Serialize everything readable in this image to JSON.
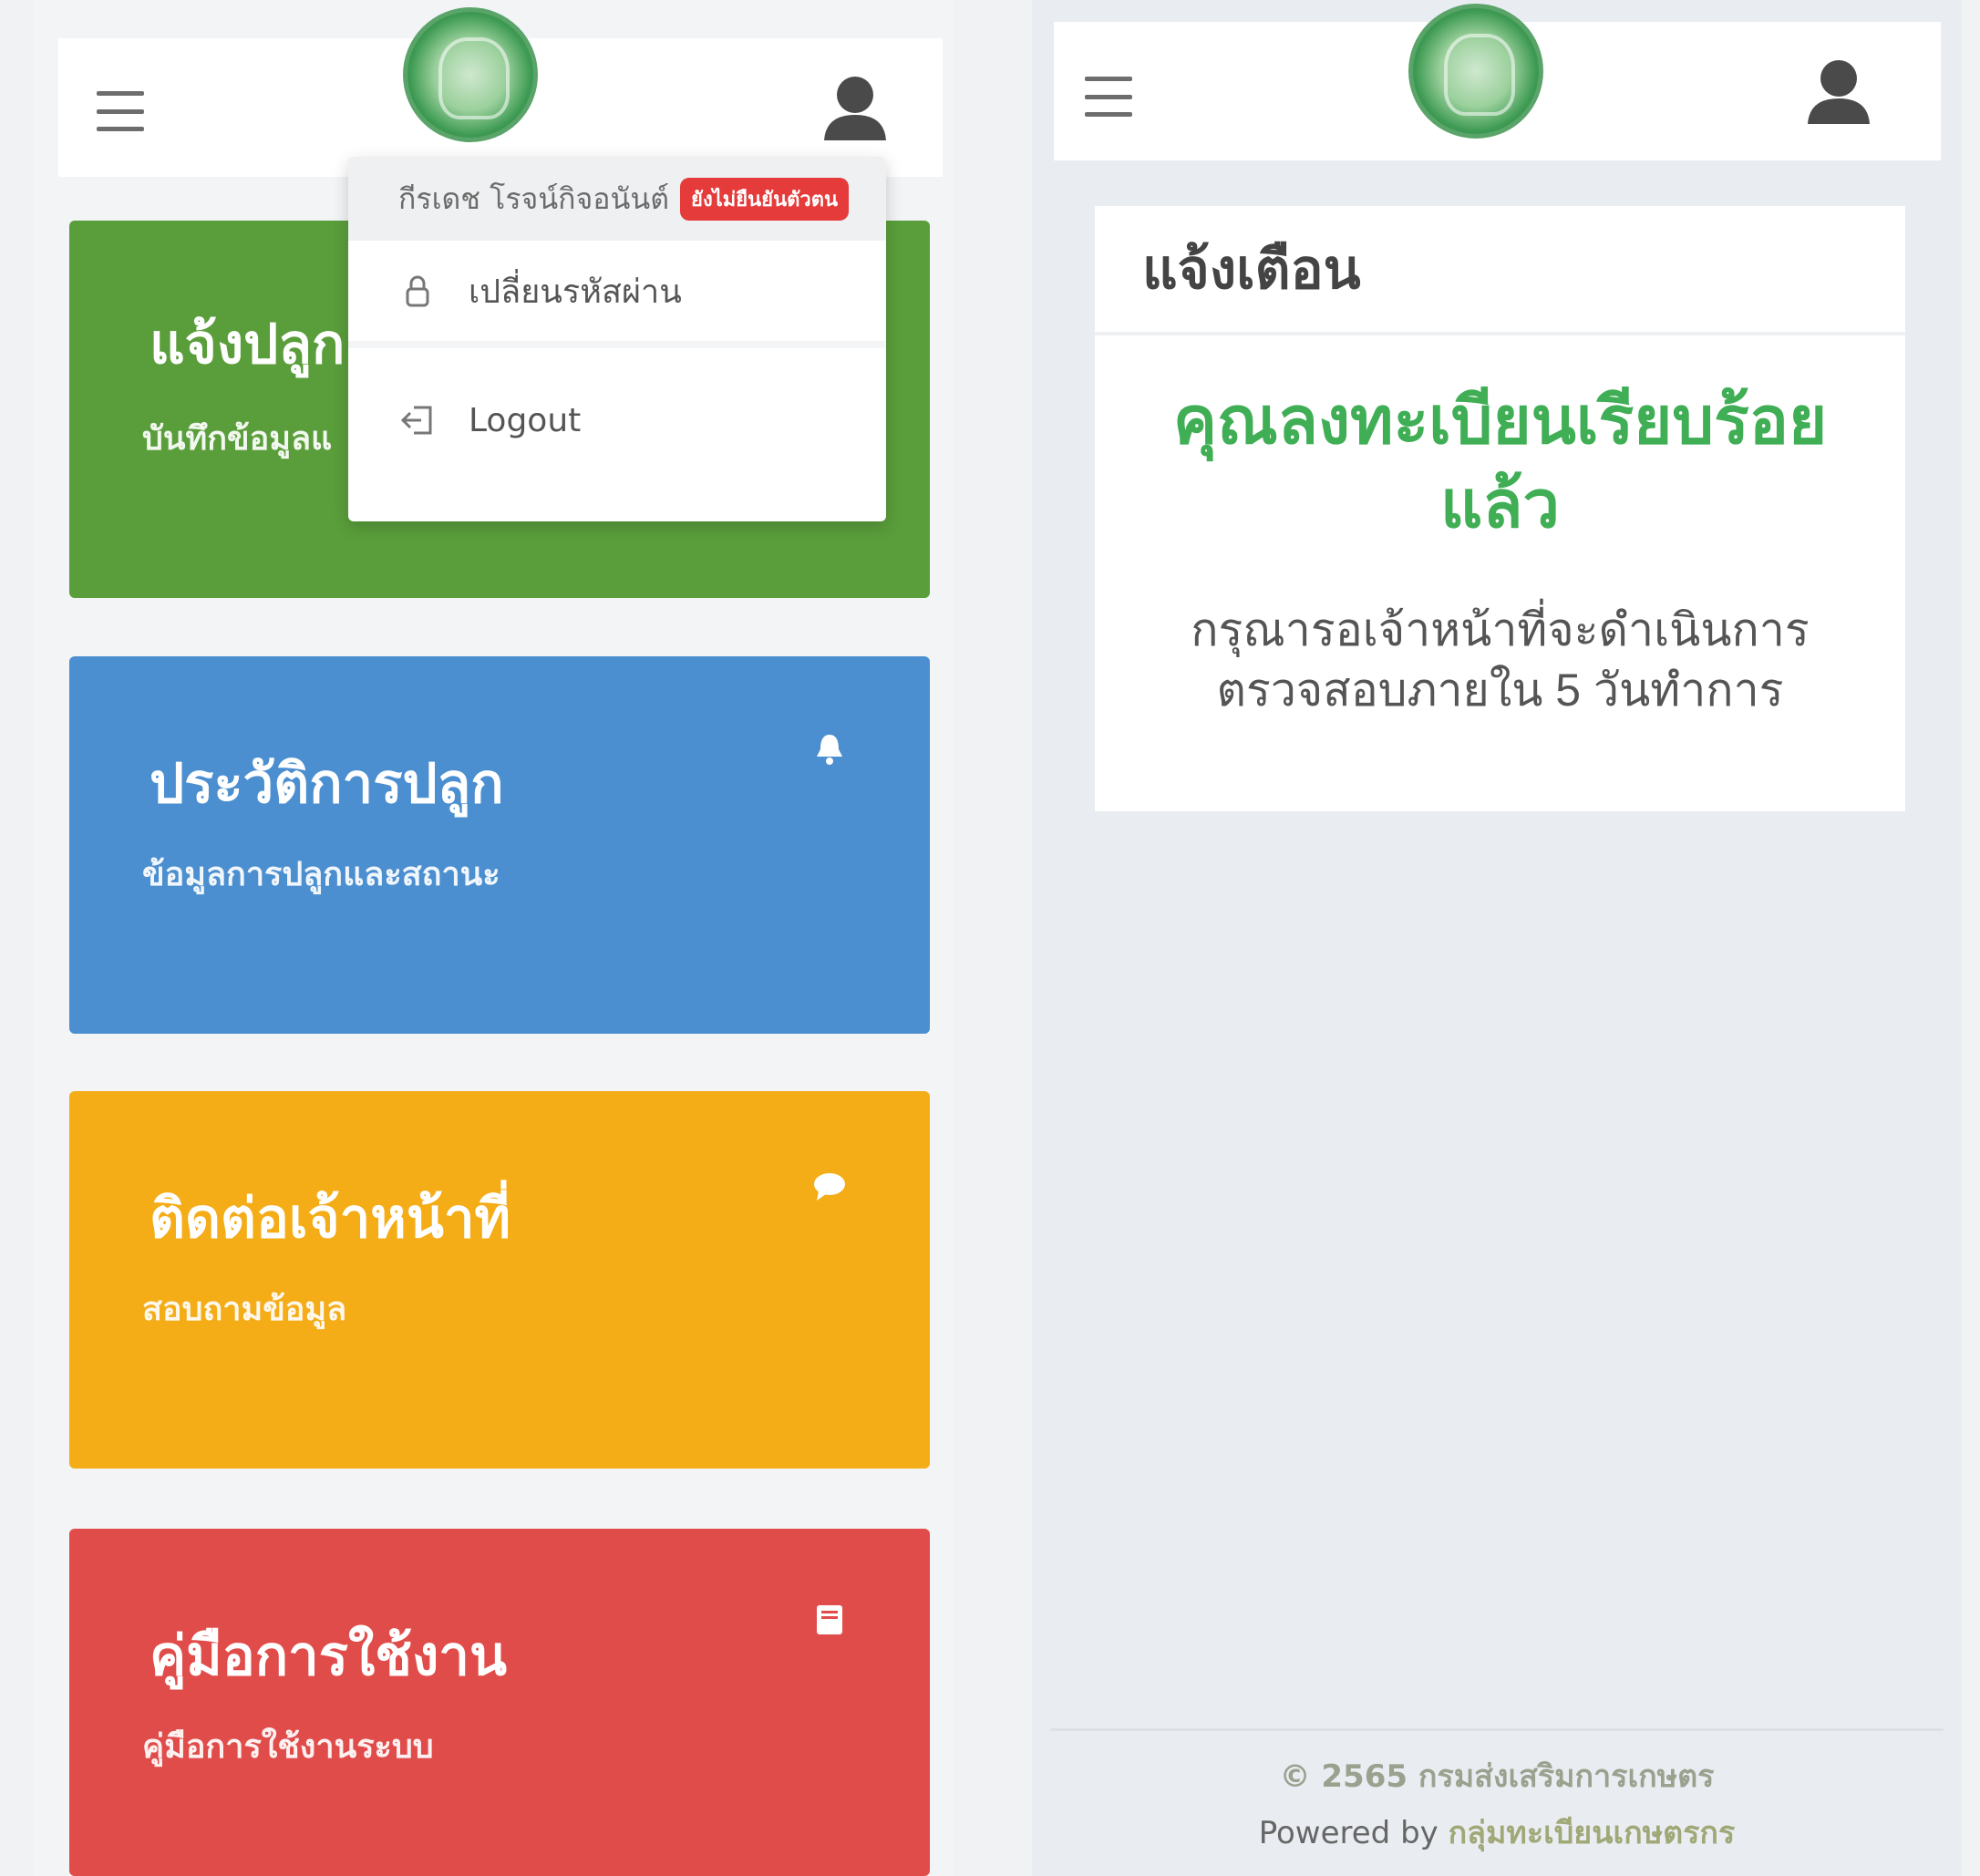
{
  "left_screen": {
    "cards": [
      {
        "title": "แจ้งปลูก",
        "subtitle": "บันทึกข้อมูลแ",
        "color": "#5a9e3b"
      },
      {
        "title": "ประวัติการปลูก",
        "subtitle": "ข้อมูลการปลูกและสถานะ",
        "color": "#4b8fd0",
        "icon": "bell-icon"
      },
      {
        "title": "ติดต่อเจ้าหน้าที่",
        "subtitle": "สอบถามข้อมูล",
        "color": "#f4ac17",
        "icon": "chat-bubble-icon"
      },
      {
        "title": "คู่มือการใช้งาน",
        "subtitle": "คู่มือการใช้งานระบบ",
        "color": "#e04c4a",
        "icon": "book-icon"
      }
    ],
    "dropdown": {
      "user_name": "กีรเดช โรจน์กิจอนันต์",
      "badge": "ยังไม่ยืนยันตัวตน",
      "change_password": "เปลี่ยนรหัสผ่าน",
      "logout": "Logout"
    }
  },
  "right_screen": {
    "panel_title": "แจ้งเตือน",
    "message": "คุณลงทะเบียนเรียบร้อยแล้ว",
    "note": "กรุณารอเจ้าหน้าที่จะดำเนินการตรวจสอบภายใน 5 วันทำการ",
    "footer_copyright": "© 2565 กรมส่งเสริมการเกษตร",
    "footer_powered_prefix": "Powered by",
    "footer_powered_link": "กลุ่มทะเบียนเกษตรกร"
  },
  "colors": {
    "success": "#3fae55",
    "badge": "#e53b3b"
  }
}
